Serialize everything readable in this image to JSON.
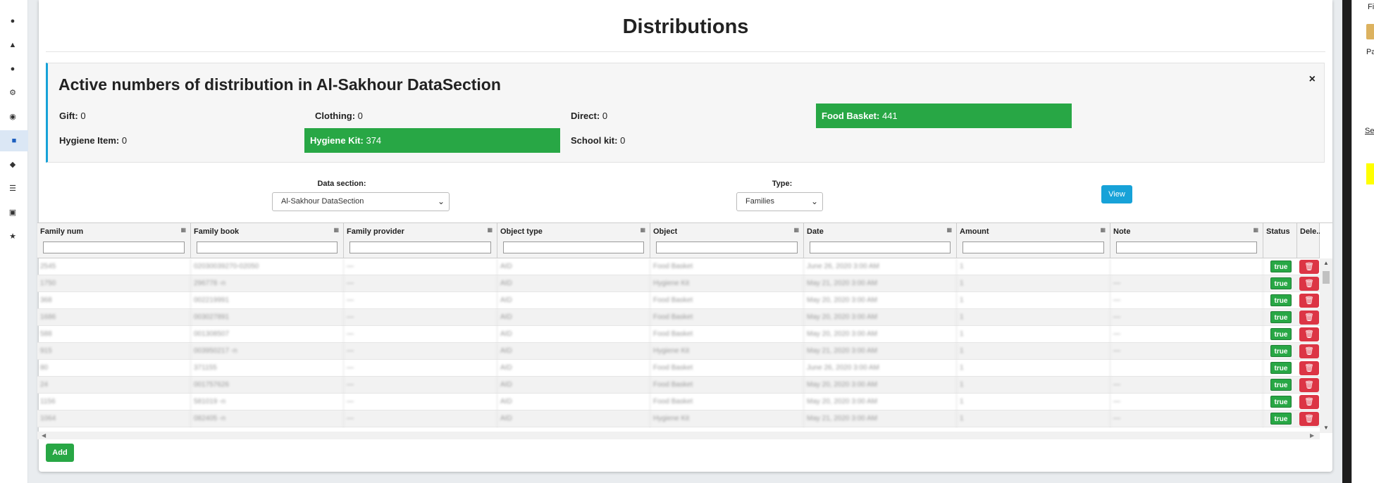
{
  "page": {
    "title": "Distributions"
  },
  "summary": {
    "heading": "Active numbers of distribution in Al-Sakhour DataSection",
    "close": "×",
    "stats": [
      {
        "label": "Gift:",
        "value": "0"
      },
      {
        "label": "Clothing:",
        "value": "0"
      },
      {
        "label": "Direct:",
        "value": "0"
      },
      {
        "label": "Food Basket:",
        "value": "441"
      },
      {
        "label": "Hygiene Item:",
        "value": "0"
      },
      {
        "label": "Hygiene Kit:",
        "value": "374"
      },
      {
        "label": "School kit:",
        "value": "0"
      }
    ]
  },
  "filters": {
    "data_section_label": "Data section:",
    "data_section_value": "Al-Sakhour DataSection",
    "type_label": "Type:",
    "type_value": "Families",
    "view_label": "View"
  },
  "grid": {
    "columns": [
      "Family num",
      "Family book",
      "Family provider",
      "Object type",
      "Object",
      "Date",
      "Amount",
      "Note",
      "Status",
      "Dele..."
    ],
    "status_label": "true",
    "rows": [
      [
        "2545",
        "02030039270-02050",
        "—",
        "AID",
        "Food Basket",
        "June 26, 2020 3:00 AM",
        "1",
        ""
      ],
      [
        "1750",
        "296778 -n",
        "—",
        "AID",
        "Hygiene Kit",
        "May 21, 2020 3:00 AM",
        "1",
        "—"
      ],
      [
        "368",
        "002219991",
        "—",
        "AID",
        "Food Basket",
        "May 20, 2020 3:00 AM",
        "1",
        "—"
      ],
      [
        "1686",
        "003027891",
        "—",
        "AID",
        "Food Basket",
        "May 20, 2020 3:00 AM",
        "1",
        "—"
      ],
      [
        "588",
        "001308507",
        "—",
        "AID",
        "Food Basket",
        "May 20, 2020 3:00 AM",
        "1",
        "—"
      ],
      [
        "915",
        "003950217 -n",
        "—",
        "AID",
        "Hygiene Kit",
        "May 21, 2020 3:00 AM",
        "1",
        "—"
      ],
      [
        "80",
        "371155",
        "—",
        "AID",
        "Food Basket",
        "June 26, 2020 3:00 AM",
        "1",
        ""
      ],
      [
        "24",
        "001757626",
        "—",
        "AID",
        "Food Basket",
        "May 20, 2020 3:00 AM",
        "1",
        "—"
      ],
      [
        "1156",
        "581019 -n",
        "—",
        "AID",
        "Food Basket",
        "May 20, 2020 3:00 AM",
        "1",
        "—"
      ],
      [
        "1064",
        "082405 -n",
        "—",
        "AID",
        "Hygiene Kit",
        "May 21, 2020 3:00 AM",
        "1",
        "—"
      ]
    ]
  },
  "actions": {
    "add_label": "Add"
  },
  "side": {
    "line1": "Fi",
    "line2": "Pa",
    "line3": "Se"
  },
  "colors": {
    "highlight": "#28a745",
    "accent": "#17a2d8",
    "danger": "#dc3545"
  }
}
